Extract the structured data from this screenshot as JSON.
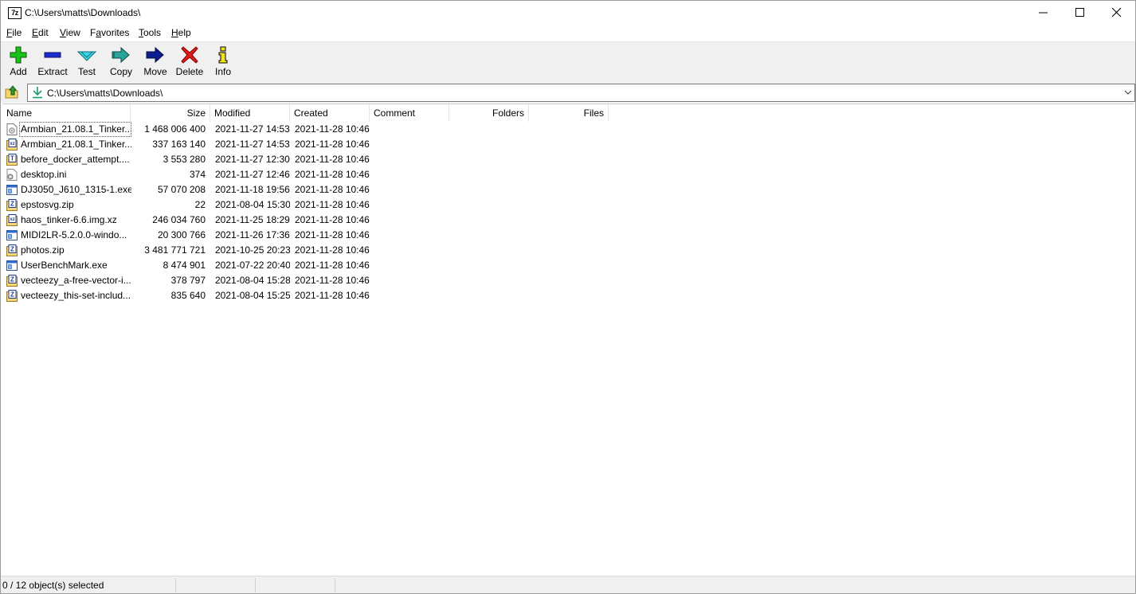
{
  "window": {
    "title": "C:\\Users\\matts\\Downloads\\",
    "app_icon_text": "7z"
  },
  "menu": [
    {
      "label": "File",
      "key": "F",
      "rest": "ile"
    },
    {
      "label": "Edit",
      "key": "E",
      "rest": "dit"
    },
    {
      "label": "View",
      "key": "V",
      "rest": "iew"
    },
    {
      "label": "Favorites",
      "key": "",
      "pre": "F",
      "keymid": "a",
      "rest": "vorites"
    },
    {
      "label": "Tools",
      "key": "T",
      "rest": "ools"
    },
    {
      "label": "Help",
      "key": "H",
      "rest": "elp"
    }
  ],
  "toolbar": {
    "add": "Add",
    "extract": "Extract",
    "test": "Test",
    "copy": "Copy",
    "move": "Move",
    "delete": "Delete",
    "info": "Info"
  },
  "address": {
    "path": "C:\\Users\\matts\\Downloads\\"
  },
  "columns": {
    "name": "Name",
    "size": "Size",
    "modified": "Modified",
    "created": "Created",
    "comment": "Comment",
    "folders": "Folders",
    "files": "Files"
  },
  "files": [
    {
      "name": "Armbian_21.08.1_Tinker...",
      "size": "1 468 006 400",
      "modified": "2021-11-27 14:53",
      "created": "2021-11-28 10:46",
      "icon": "disk-image-icon"
    },
    {
      "name": "Armbian_21.08.1_Tinker...",
      "size": "337 163 140",
      "modified": "2021-11-27 14:53",
      "created": "2021-11-28 10:46",
      "icon": "xz-archive-icon"
    },
    {
      "name": "before_docker_attempt....",
      "size": "3 553 280",
      "modified": "2021-11-27 12:30",
      "created": "2021-11-28 10:46",
      "icon": "tar-archive-icon"
    },
    {
      "name": "desktop.ini",
      "size": "374",
      "modified": "2021-11-27 12:46",
      "created": "2021-11-28 10:46",
      "icon": "settings-file-icon"
    },
    {
      "name": "DJ3050_J610_1315-1.exe",
      "size": "57 070 208",
      "modified": "2021-11-18 19:56",
      "created": "2021-11-28 10:46",
      "icon": "exe-icon"
    },
    {
      "name": "epstosvg.zip",
      "size": "22",
      "modified": "2021-08-04 15:30",
      "created": "2021-11-28 10:46",
      "icon": "zip-archive-icon"
    },
    {
      "name": "haos_tinker-6.6.img.xz",
      "size": "246 034 760",
      "modified": "2021-11-25 18:29",
      "created": "2021-11-28 10:46",
      "icon": "xz-archive-icon"
    },
    {
      "name": "MIDI2LR-5.2.0.0-windo...",
      "size": "20 300 766",
      "modified": "2021-11-26 17:36",
      "created": "2021-11-28 10:46",
      "icon": "exe-icon"
    },
    {
      "name": "photos.zip",
      "size": "3 481 771 721",
      "modified": "2021-10-25 20:23",
      "created": "2021-11-28 10:46",
      "icon": "zip-archive-icon"
    },
    {
      "name": "UserBenchMark.exe",
      "size": "8 474 901",
      "modified": "2021-07-22 20:40",
      "created": "2021-11-28 10:46",
      "icon": "exe-icon"
    },
    {
      "name": "vecteezy_a-free-vector-i...",
      "size": "378 797",
      "modified": "2021-08-04 15:28",
      "created": "2021-11-28 10:46",
      "icon": "zip-archive-icon"
    },
    {
      "name": "vecteezy_this-set-includ...",
      "size": "835 640",
      "modified": "2021-08-04 15:25",
      "created": "2021-11-28 10:46",
      "icon": "zip-archive-icon"
    }
  ],
  "status": {
    "selection": "0 / 12 object(s) selected"
  }
}
